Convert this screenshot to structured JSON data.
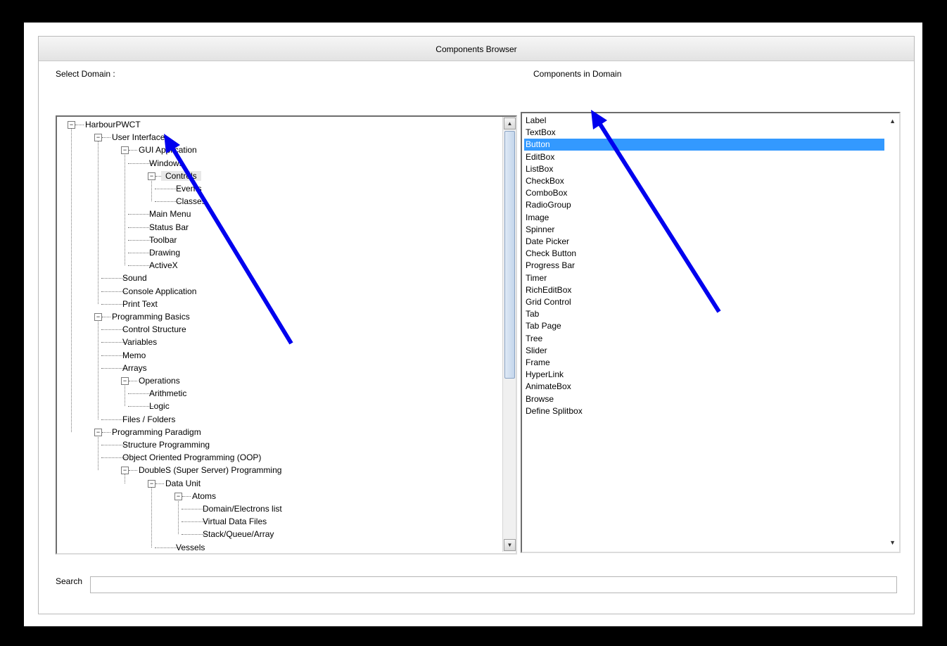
{
  "window": {
    "title": "Components Browser"
  },
  "labels": {
    "select_domain": "Select Domain :",
    "components_in_domain": "Components in Domain",
    "search": "Search"
  },
  "search": {
    "value": ""
  },
  "tree": [
    {
      "label": "HarbourPWCT",
      "level": 0,
      "expanded": true
    },
    {
      "label": "User Interface",
      "level": 1,
      "expanded": true
    },
    {
      "label": "GUI Application",
      "level": 2,
      "expanded": true
    },
    {
      "label": "Windows",
      "level": 3
    },
    {
      "label": "Controls",
      "level": 3,
      "expanded": true,
      "selected": true
    },
    {
      "label": "Events",
      "level": 4
    },
    {
      "label": "Classes",
      "level": 4
    },
    {
      "label": "Main Menu",
      "level": 3
    },
    {
      "label": "Status Bar",
      "level": 3
    },
    {
      "label": "Toolbar",
      "level": 3
    },
    {
      "label": "Drawing",
      "level": 3
    },
    {
      "label": "ActiveX",
      "level": 3
    },
    {
      "label": "Sound",
      "level": 2
    },
    {
      "label": "Console Application",
      "level": 2
    },
    {
      "label": "Print Text",
      "level": 2
    },
    {
      "label": "Programming Basics",
      "level": 1,
      "expanded": true
    },
    {
      "label": "Control Structure",
      "level": 2
    },
    {
      "label": "Variables",
      "level": 2
    },
    {
      "label": "Memo",
      "level": 2
    },
    {
      "label": "Arrays",
      "level": 2
    },
    {
      "label": "Operations",
      "level": 2,
      "expanded": true
    },
    {
      "label": "Arithmetic",
      "level": 3
    },
    {
      "label": "Logic",
      "level": 3
    },
    {
      "label": "Files / Folders",
      "level": 2
    },
    {
      "label": "Programming Paradigm",
      "level": 1,
      "expanded": true
    },
    {
      "label": "Structure Programming",
      "level": 2
    },
    {
      "label": "Object Oriented Programming (OOP)",
      "level": 2
    },
    {
      "label": "DoubleS (Super Server) Programming",
      "level": 2,
      "expanded": true
    },
    {
      "label": "Data Unit",
      "level": 3,
      "expanded": true
    },
    {
      "label": "Atoms",
      "level": 4,
      "expanded": true
    },
    {
      "label": "Domain/Electrons list",
      "level": 5
    },
    {
      "label": "Virtual Data Files",
      "level": 5
    },
    {
      "label": "Stack/Queue/Array",
      "level": 5
    },
    {
      "label": "Vessels",
      "level": 4
    }
  ],
  "components": [
    "Label",
    "TextBox",
    "Button",
    "EditBox",
    "ListBox",
    "CheckBox",
    "ComboBox",
    "RadioGroup",
    "Image",
    "Spinner",
    "Date Picker",
    "Check Button",
    "Progress Bar",
    "Timer",
    "RichEditBox",
    "Grid Control",
    "Tab",
    "Tab Page",
    "Tree",
    "Slider",
    "Frame",
    "HyperLink",
    "AnimateBox",
    "Browse",
    "Define Splitbox"
  ],
  "selected_component": "Button",
  "colors": {
    "selection": "#3399ff",
    "annotation_arrow": "#0000ee"
  }
}
